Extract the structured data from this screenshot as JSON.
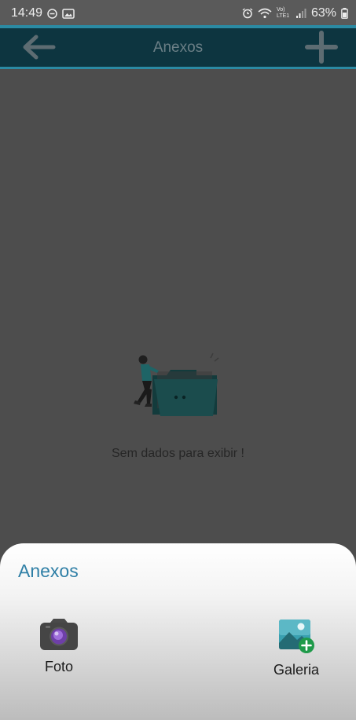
{
  "status_bar": {
    "time": "14:49",
    "battery": "63%",
    "network_label": "Vo) LTE1"
  },
  "app_bar": {
    "title": "Anexos"
  },
  "empty_state": {
    "message": "Sem dados para exibir !"
  },
  "bottom_sheet": {
    "title": "Anexos",
    "options": [
      {
        "label": "Foto",
        "icon": "camera-icon"
      },
      {
        "label": "Galeria",
        "icon": "gallery-add-icon"
      }
    ]
  },
  "colors": {
    "app_bar_bg": "#0d3540",
    "accent": "#2b8aa3",
    "sheet_title": "#2f7fa6",
    "scrim": "#4d4d4d"
  }
}
